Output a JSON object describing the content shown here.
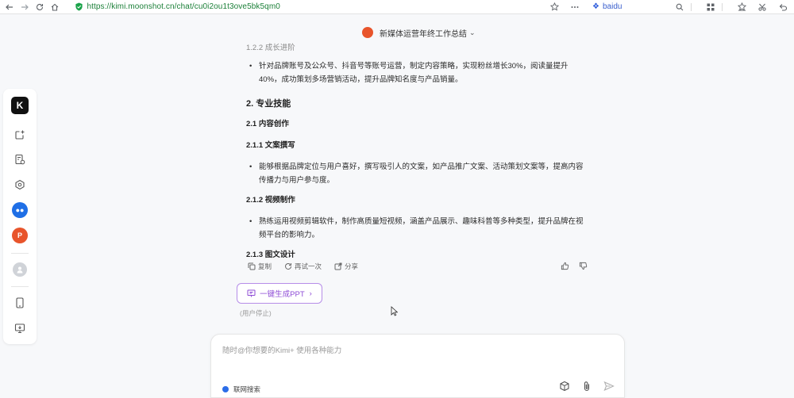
{
  "browser": {
    "url": "https://kimi.moonshot.cn/chat/cu0i2ou1t3ove5bk5qm0",
    "search_engine": "baidu"
  },
  "chat": {
    "title": "新媒体运营年终工作总结"
  },
  "content": {
    "section_1_2_2": "1.2.2 成长进阶",
    "bullet_1": "针对品牌账号及公众号、抖音号等账号运营，制定内容策略，实现粉丝增长30%，阅读量提升40%，成功策划多场营销活动，提升品牌知名度与产品销量。",
    "h2_skills": "2. 专业技能",
    "h3_content_creation": "2.1 内容创作",
    "h3_copywriting": "2.1.1 文案撰写",
    "bullet_2": "能够根据品牌定位与用户喜好，撰写吸引人的文案，如产品推广文案、活动策划文案等，提高内容传播力与用户参与度。",
    "h3_video": "2.1.2 视频制作",
    "bullet_3": "熟练运用视频剪辑软件，制作高质量短视频，涵盖产品展示、趣味科普等多种类型，提升品牌在视频平台的影响力。",
    "h3_graphic": "2.1.3 图文设计"
  },
  "actions": {
    "copy": "复制",
    "retry": "再试一次",
    "share": "分享"
  },
  "ppt": {
    "button": "一键生成PPT",
    "note": "(用户停止)"
  },
  "input": {
    "placeholder": "随时@你想要的Kimi+ 使用各种能力",
    "net_search": "联网搜索"
  }
}
